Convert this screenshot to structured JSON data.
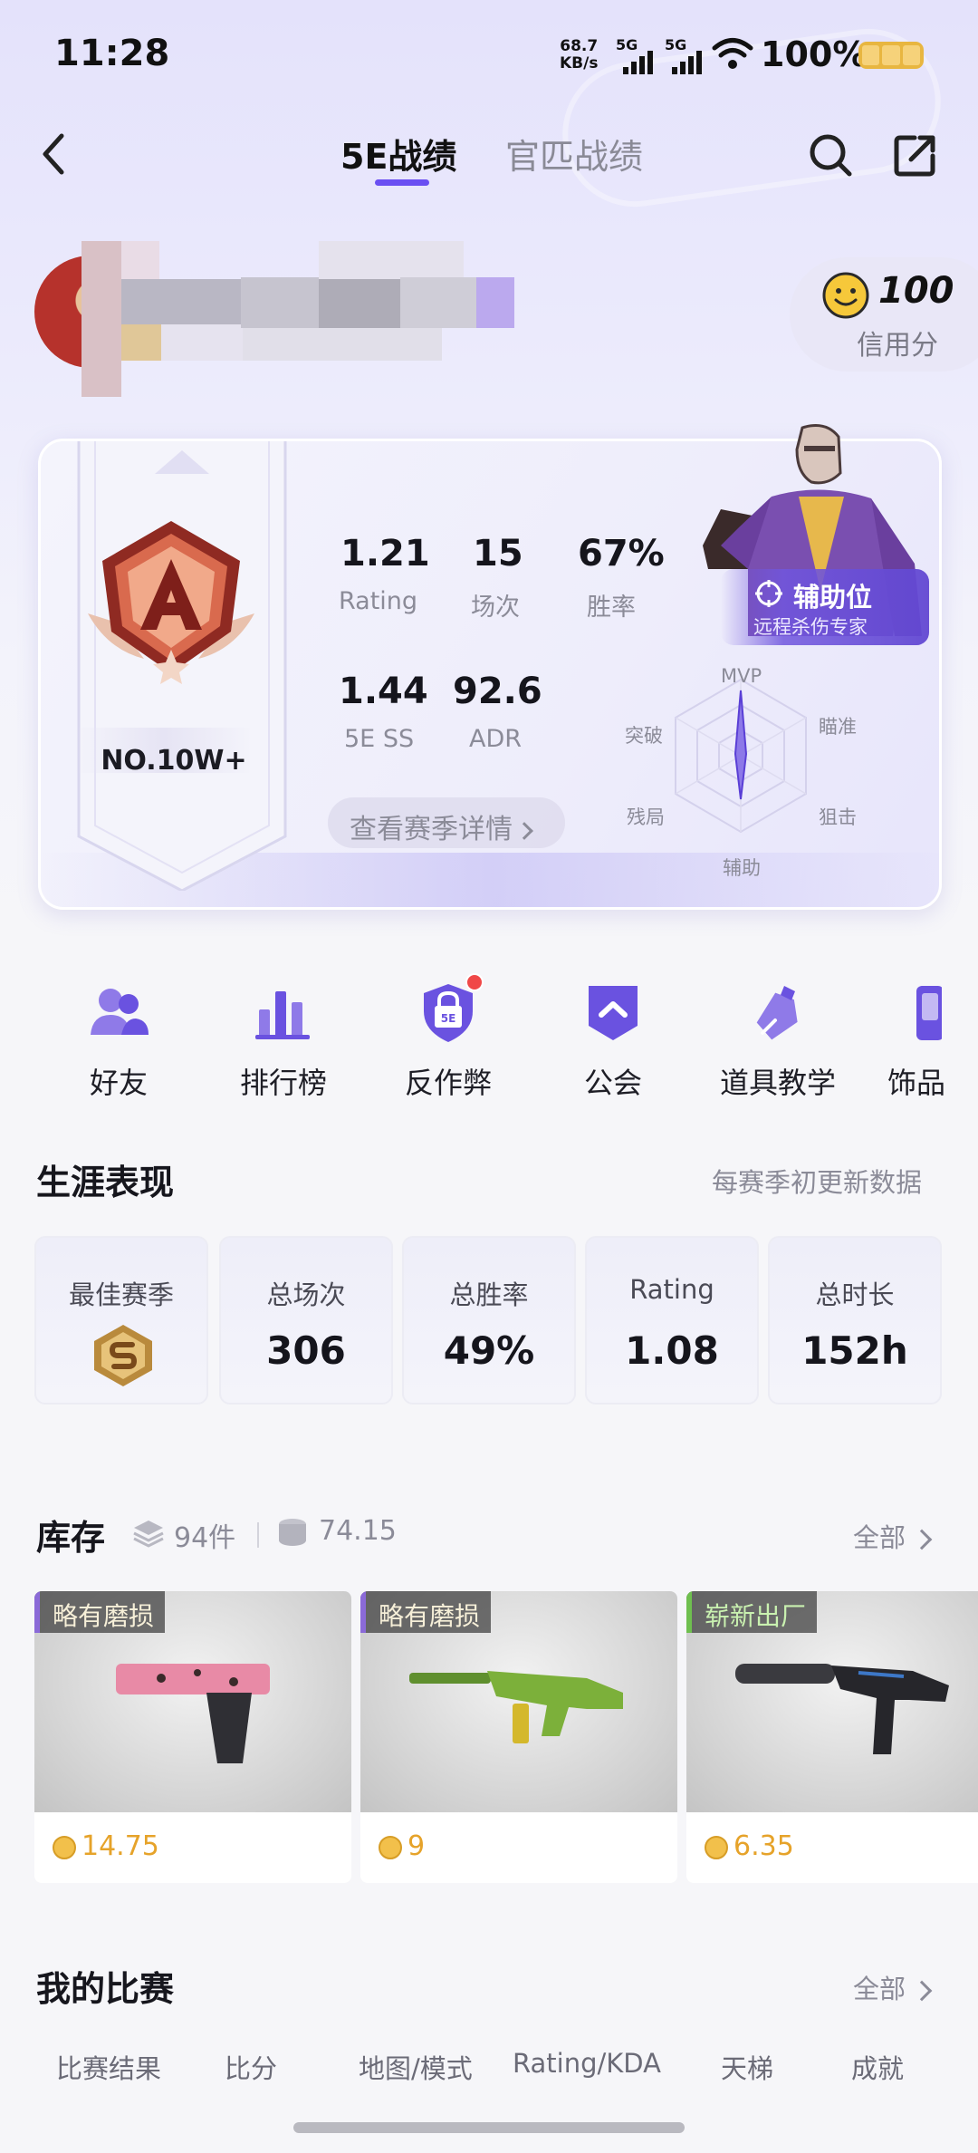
{
  "status_bar": {
    "time": "11:28",
    "net_speed_value": "68.7",
    "net_speed_unit": "KB/s",
    "signal1": "5G",
    "signal2": "5G",
    "battery": "100%"
  },
  "nav": {
    "tabs": [
      {
        "label": "5E战绩",
        "active": true
      },
      {
        "label": "官匹战绩",
        "active": false
      }
    ]
  },
  "profile": {
    "credit_value": "100",
    "credit_label": "信用分"
  },
  "season": {
    "rank": "NO.10W+",
    "stats": [
      {
        "value": "1.21",
        "label": "Rating"
      },
      {
        "value": "15",
        "label": "场次"
      },
      {
        "value": "67%",
        "label": "胜率"
      },
      {
        "value": "1.44",
        "label": "5E SS"
      },
      {
        "value": "92.6",
        "label": "ADR"
      }
    ],
    "detail_button": "查看赛季详情",
    "role_name": "辅助位",
    "role_desc": "远程杀伤专家",
    "radar_labels": {
      "top": "MVP",
      "upper_right": "瞄准",
      "lower_right": "狙击",
      "bottom": "辅助",
      "lower_left": "残局",
      "upper_left": "突破"
    }
  },
  "quick_menu": [
    {
      "label": "好友",
      "icon": "friends-icon"
    },
    {
      "label": "排行榜",
      "icon": "leaderboard-icon"
    },
    {
      "label": "反作弊",
      "icon": "anticheat-shield-icon"
    },
    {
      "label": "公会",
      "icon": "guild-icon"
    },
    {
      "label": "道具教学",
      "icon": "utility-tutorial-icon"
    },
    {
      "label": "饰品",
      "icon": "skins-icon"
    }
  ],
  "career": {
    "title": "生涯表现",
    "note": "每赛季初更新数据",
    "tiles": [
      {
        "label": "最佳赛季",
        "value": ""
      },
      {
        "label": "总场次",
        "value": "306"
      },
      {
        "label": "总胜率",
        "value": "49%"
      },
      {
        "label": "Rating",
        "value": "1.08"
      },
      {
        "label": "总时长",
        "value": "152h"
      }
    ]
  },
  "inventory": {
    "title": "库存",
    "count": "94件",
    "value": "74.15",
    "all_label": "全部",
    "items": [
      {
        "wear": "略有磨损",
        "price": "14.75"
      },
      {
        "wear": "略有磨损",
        "price": "9"
      },
      {
        "wear": "崭新出厂",
        "price": "6.35"
      }
    ]
  },
  "matches": {
    "title": "我的比赛",
    "all_label": "全部",
    "columns": [
      "比赛结果",
      "比分",
      "地图/模式",
      "Rating/KDA",
      "天梯",
      "成就"
    ]
  },
  "colors": {
    "accent": "#6a4ff2",
    "coin": "#e6a32a",
    "badge_dot": "#f04848"
  }
}
